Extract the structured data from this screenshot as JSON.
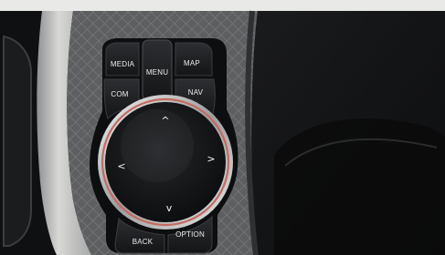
{
  "controller": {
    "buttons": {
      "media": "MEDIA",
      "menu": "MENU",
      "map": "MAP",
      "com": "COM",
      "nav": "NAV",
      "back": "BACK",
      "option": "OPTION"
    },
    "arrows": {
      "up": "^",
      "down": "v",
      "left": "<",
      "right": ">"
    }
  },
  "colors": {
    "accent_ring": "#c46a60",
    "label_text": "#ececec",
    "knob_face": "#121314",
    "panel_trim": "#c9c9c6"
  }
}
